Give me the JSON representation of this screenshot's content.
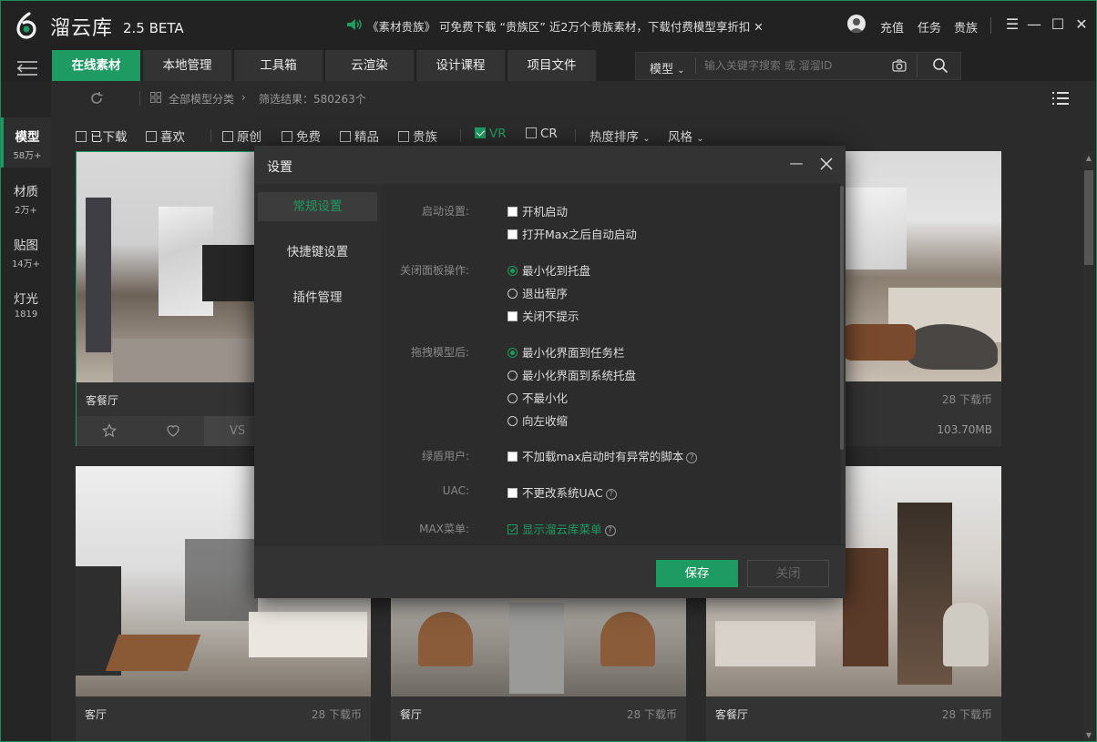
{
  "app": {
    "brand": "溜云库",
    "version": "2.5 BETA"
  },
  "notice": {
    "text": "《素材贵族》 可免费下载 “贵族区” 近2万个贵族素材，下载付费模型享折扣 ✕"
  },
  "top_links": [
    "充值",
    "任务",
    "贵族"
  ],
  "tabs": [
    "在线素材",
    "本地管理",
    "工具箱",
    "云渲染",
    "设计课程",
    "项目文件"
  ],
  "search": {
    "type_label": "模型",
    "placeholder": "输入关键字搜索 或 溜溜ID"
  },
  "breadcrumb": {
    "category": "全部模型分类",
    "results": "筛选结果：580263个"
  },
  "sidebar": {
    "items": [
      {
        "label": "模型",
        "count": "58万+"
      },
      {
        "label": "材质",
        "count": "2万+"
      },
      {
        "label": "贴图",
        "count": "14万+"
      },
      {
        "label": "灯光",
        "count": "1819"
      }
    ]
  },
  "filters": {
    "checks": [
      {
        "label": "已下载",
        "checked": false
      },
      {
        "label": "喜欢",
        "checked": false
      },
      {
        "label": "原创",
        "checked": false
      },
      {
        "label": "免费",
        "checked": false
      },
      {
        "label": "精品",
        "checked": false
      },
      {
        "label": "贵族",
        "checked": false
      },
      {
        "label": "VR",
        "checked": true
      },
      {
        "label": "CR",
        "checked": false
      }
    ],
    "sort": "热度排序",
    "style": "风格"
  },
  "cards": [
    {
      "title": "客餐厅",
      "vs": "VS"
    },
    {
      "cost": "28 下载币",
      "size": "103.70MB"
    },
    {
      "title": "客厅",
      "cost": "28 下载币"
    },
    {
      "title": "餐厅",
      "cost": "28 下载币"
    },
    {
      "title": "客餐厅",
      "cost": "28 下载币"
    }
  ],
  "dialog": {
    "title": "设置",
    "nav": [
      "常规设置",
      "快捷键设置",
      "插件管理"
    ],
    "sections": {
      "startup": {
        "label": "启动设置:",
        "opt1": "开机启动",
        "opt2": "打开Max之后自动启动"
      },
      "close": {
        "label": "关闭面板操作:",
        "opt1": "最小化到托盘",
        "opt2": "退出程序",
        "opt3": "关闭不提示"
      },
      "drag": {
        "label": "拖拽模型后:",
        "opt1": "最小化界面到任务栏",
        "opt2": "最小化界面到系统托盘",
        "opt3": "不最小化",
        "opt4": "向左收缩"
      },
      "green": {
        "label": "绿盾用户:",
        "opt1": "不加载max启动时有异常的脚本"
      },
      "uac": {
        "label": "UAC:",
        "opt1": "不更改系统UAC"
      },
      "maxmenu": {
        "label": "MAX菜单:",
        "opt1": "显示溜云库菜单"
      }
    },
    "save": "保存",
    "close": "关闭"
  },
  "colors": {
    "accent": "#1e9b62",
    "bg": "#2b2b2b"
  }
}
